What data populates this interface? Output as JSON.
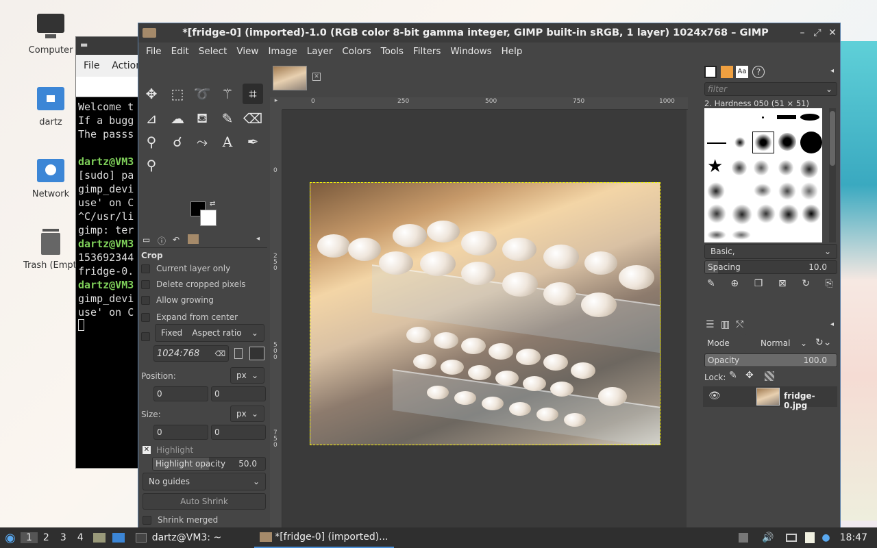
{
  "desktop": {
    "icons": [
      {
        "label": "Computer",
        "icon": "computer-icon"
      },
      {
        "label": "dartz",
        "icon": "home-folder-icon"
      },
      {
        "label": "Network",
        "icon": "network-folder-icon"
      },
      {
        "label": "Trash (Empty)",
        "icon": "trash-icon"
      }
    ]
  },
  "terminal": {
    "menu": [
      "File",
      "Actions"
    ],
    "lines": [
      {
        "text": "Welcome t",
        "green": false
      },
      {
        "text": "If a bugg",
        "green": false
      },
      {
        "text": "The passs",
        "green": false
      },
      {
        "text": "",
        "green": false
      },
      {
        "text": "dartz@VM3",
        "green": true
      },
      {
        "text": "[sudo] pa",
        "green": false
      },
      {
        "text": "gimp_devi",
        "green": false
      },
      {
        "text": "use' on C",
        "green": false
      },
      {
        "text": "^C/usr/li",
        "green": false
      },
      {
        "text": "gimp: ter",
        "green": false
      },
      {
        "text": "dartz@VM3",
        "green": true
      },
      {
        "text": "153692344",
        "green": false
      },
      {
        "text": "fridge-0.",
        "green": false
      },
      {
        "text": "dartz@VM3",
        "green": true
      },
      {
        "text": "gimp_devi",
        "green": false
      },
      {
        "text": "use' on C",
        "green": false
      }
    ]
  },
  "gimp": {
    "title": "*[fridge-0] (imported)-1.0 (RGB color 8-bit gamma integer, GIMP built-in sRGB, 1 layer) 1024x768 – GIMP",
    "menu": [
      "File",
      "Edit",
      "Select",
      "View",
      "Image",
      "Layer",
      "Colors",
      "Tools",
      "Filters",
      "Windows",
      "Help"
    ],
    "tool_options": {
      "heading": "Crop",
      "current_layer_only": "Current layer only",
      "delete_cropped": "Delete cropped pixels",
      "allow_growing": "Allow growing",
      "expand_center": "Expand from center",
      "fixed": "Fixed",
      "aspect": "Aspect ratio",
      "ratio_value": "1024:768",
      "position_label": "Position:",
      "unit": "px",
      "pos_x": "0",
      "pos_y": "0",
      "size_label": "Size:",
      "size_x": "0",
      "size_y": "0",
      "highlight": "Highlight",
      "highlight_opacity_label": "Highlight opacity",
      "highlight_opacity_value": "50.0",
      "guides": "No guides",
      "auto_shrink": "Auto Shrink",
      "shrink_merged": "Shrink merged"
    },
    "ruler_h": [
      "0",
      "250",
      "500",
      "750",
      "1000"
    ],
    "ruler_v": [
      "0",
      "250",
      "500",
      "750"
    ],
    "brushes": {
      "filter_placeholder": "filter",
      "selected": "2. Hardness 050 (51 × 51)",
      "preset": "Basic,",
      "spacing_label": "Spacing",
      "spacing_value": "10.0"
    },
    "layers": {
      "mode_label": "Mode",
      "mode_value": "Normal",
      "opacity_label": "Opacity",
      "opacity_value": "100.0",
      "lock_label": "Lock:",
      "layer_name": "fridge-0.jpg"
    }
  },
  "taskbar": {
    "workspaces": [
      "1",
      "2",
      "3",
      "4"
    ],
    "tasks": [
      "dartz@VM3: ~",
      "*[fridge-0] (imported)..."
    ],
    "clock": "18:47"
  }
}
